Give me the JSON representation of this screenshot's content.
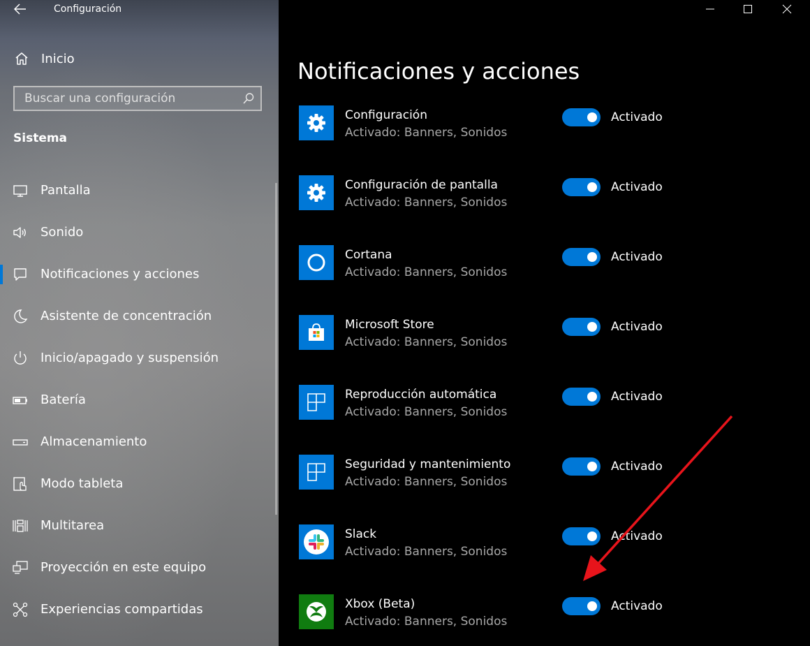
{
  "window": {
    "title": "Configuración",
    "back_icon": "back-arrow-icon"
  },
  "sidebar": {
    "home_label": "Inicio",
    "search_placeholder": "Buscar una configuración",
    "section_title": "Sistema",
    "items": [
      {
        "label": "Pantalla",
        "icon": "display-icon",
        "selected": false
      },
      {
        "label": "Sonido",
        "icon": "speaker-icon",
        "selected": false
      },
      {
        "label": "Notificaciones y acciones",
        "icon": "notification-icon",
        "selected": true
      },
      {
        "label": "Asistente de concentración",
        "icon": "moon-icon",
        "selected": false
      },
      {
        "label": "Inicio/apagado y suspensión",
        "icon": "power-icon",
        "selected": false
      },
      {
        "label": "Batería",
        "icon": "battery-icon",
        "selected": false
      },
      {
        "label": "Almacenamiento",
        "icon": "storage-icon",
        "selected": false
      },
      {
        "label": "Modo tableta",
        "icon": "tablet-icon",
        "selected": false
      },
      {
        "label": "Multitarea",
        "icon": "multitask-icon",
        "selected": false
      },
      {
        "label": "Proyección en este equipo",
        "icon": "projection-icon",
        "selected": false
      },
      {
        "label": "Experiencias compartidas",
        "icon": "shared-icon",
        "selected": false
      }
    ]
  },
  "main": {
    "title": "Notificaciones y acciones",
    "apps": [
      {
        "name": "Configuración",
        "status": "Activado: Banners, Sonidos",
        "toggle_label": "Activado",
        "icon": "gear-icon",
        "tile_color": "#0078d7"
      },
      {
        "name": "Configuración de pantalla",
        "status": "Activado: Banners, Sonidos",
        "toggle_label": "Activado",
        "icon": "gear-icon",
        "tile_color": "#0078d7"
      },
      {
        "name": "Cortana",
        "status": "Activado: Banners, Sonidos",
        "toggle_label": "Activado",
        "icon": "cortana-ring-icon",
        "tile_color": "#0078d7"
      },
      {
        "name": "Microsoft Store",
        "status": "Activado: Banners, Sonidos",
        "toggle_label": "Activado",
        "icon": "store-bag-icon",
        "tile_color": "#0078d7"
      },
      {
        "name": "Reproducción automática",
        "status": "Activado: Banners, Sonidos",
        "toggle_label": "Activado",
        "icon": "autoplay-grid-icon",
        "tile_color": "#0078d7"
      },
      {
        "name": "Seguridad y mantenimiento",
        "status": "Activado: Banners, Sonidos",
        "toggle_label": "Activado",
        "icon": "security-grid-icon",
        "tile_color": "#0078d7"
      },
      {
        "name": "Slack",
        "status": "Activado: Banners, Sonidos",
        "toggle_label": "Activado",
        "icon": "slack-logo-icon",
        "tile_color": "#0078d7"
      },
      {
        "name": "Xbox (Beta)",
        "status": "Activado: Banners, Sonidos",
        "toggle_label": "Activado",
        "icon": "xbox-logo-icon",
        "tile_color": "#107c10"
      }
    ]
  },
  "colors": {
    "accent": "#0078d7",
    "xbox_green": "#107c10",
    "annotation_arrow": "#e8141b"
  }
}
